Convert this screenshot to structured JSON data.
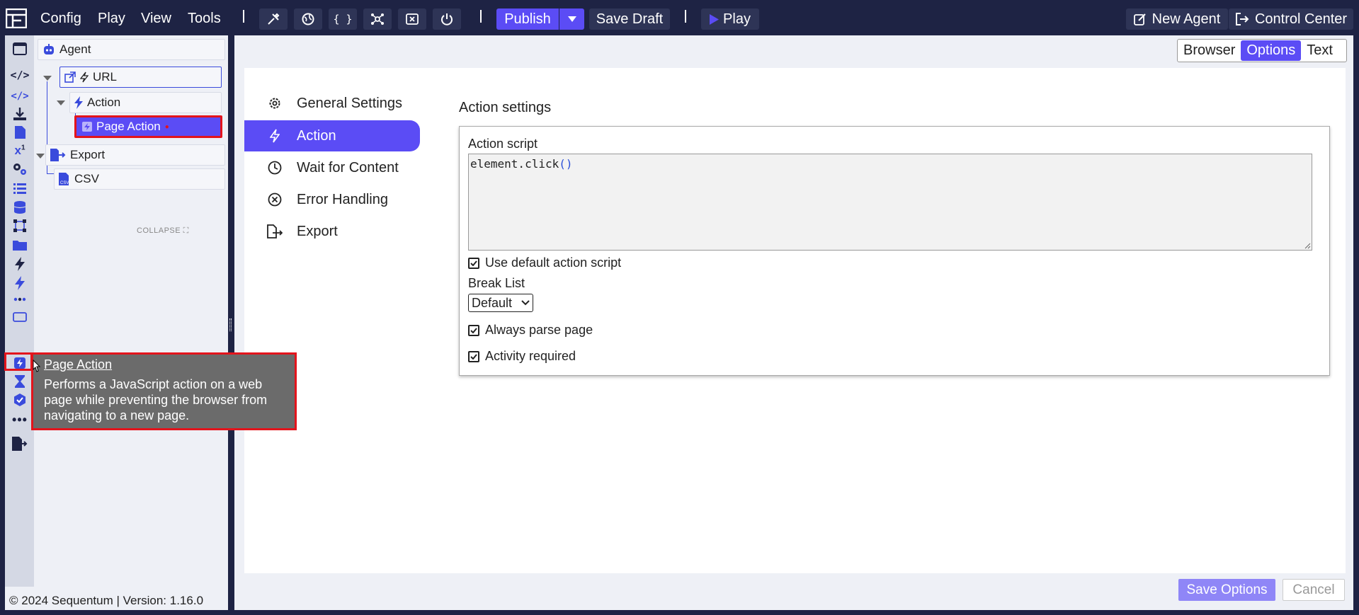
{
  "menu": {
    "items": [
      "Config",
      "Play",
      "View",
      "Tools"
    ]
  },
  "toolbar": {
    "publish": "Publish",
    "save_draft": "Save Draft",
    "play": "Play",
    "new_agent": "New Agent",
    "control_center": "Control Center"
  },
  "tree": {
    "agent": "Agent",
    "url": "URL",
    "action": "Action",
    "page_action": "Page Action",
    "export": "Export",
    "csv": "CSV",
    "collapse": "COLLAPSE"
  },
  "view_tabs": [
    "Browser",
    "Options",
    "Text"
  ],
  "settings_nav": [
    "General Settings",
    "Action",
    "Wait for Content",
    "Error Handling",
    "Export"
  ],
  "action_settings": {
    "title": "Action settings",
    "script_label": "Action script",
    "script_code": "element.click",
    "script_parens": "()",
    "use_default": "Use default action script",
    "break_list_label": "Break List",
    "break_list_value": "Default",
    "always_parse": "Always parse page",
    "activity_required": "Activity required"
  },
  "buttons": {
    "save_options": "Save Options",
    "cancel": "Cancel"
  },
  "tooltip": {
    "title": "Page Action",
    "description": "Performs a JavaScript action on a web page while preventing the browser from navigating to a new page."
  },
  "footer": "© 2024 Sequentum | Version: 1.16.0",
  "colors": {
    "accent": "#5b4cf5",
    "topbar": "#1e2344",
    "highlight": "#e3141c"
  }
}
